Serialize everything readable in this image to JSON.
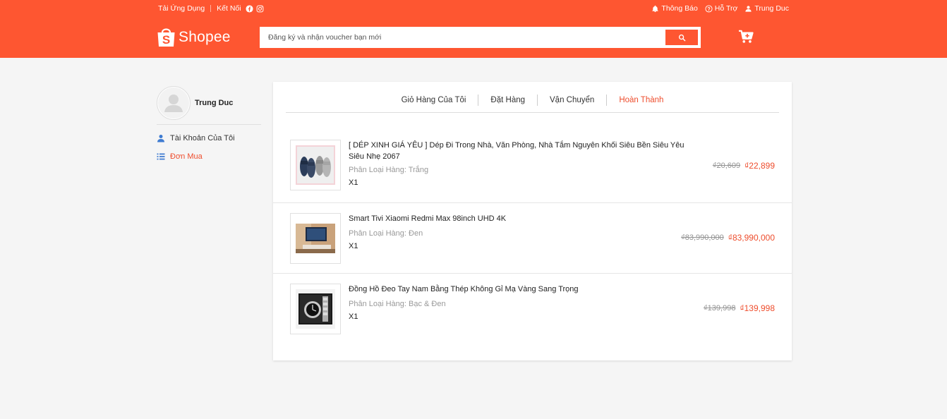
{
  "colors": {
    "brand": "#fe5631",
    "accent": "#ee4d2d"
  },
  "topbar": {
    "download_app": "Tải Ứng Dụng",
    "connect": "Kết Nối",
    "notifications": "Thông Báo",
    "help": "Hỗ Trợ",
    "user": "Trung Duc"
  },
  "logo": {
    "text": "Shopee"
  },
  "search": {
    "placeholder": "Đăng ký và nhận voucher bạn mới"
  },
  "sidebar": {
    "username": "Trung Duc",
    "items": [
      {
        "label": "Tài Khoản Của Tôi",
        "icon": "user-icon"
      },
      {
        "label": "Đơn Mua",
        "icon": "list-icon",
        "active": true
      }
    ]
  },
  "tabs": [
    {
      "label": "Giỏ Hàng Của Tôi"
    },
    {
      "label": "Đặt Hàng"
    },
    {
      "label": "Vận Chuyển"
    },
    {
      "label": "Hoàn Thành",
      "active": true
    }
  ],
  "orders": [
    {
      "title": "[ DÉP XINH GIÁ YÊU ] Dép Đi Trong Nhà, Văn Phòng, Nhà Tắm Nguyên Khối Siêu Bền Siêu Yêu Siêu Nhẹ 2067",
      "variant": "Phân Loại Hàng: Trắng",
      "qty": "X1",
      "old_price": "₫20,609",
      "price": "₫22,899"
    },
    {
      "title": "Smart Tivi Xiaomi Redmi Max 98inch UHD 4K",
      "variant": "Phân Loại Hàng: Đen",
      "qty": "X1",
      "old_price": "₫83,990,000",
      "price": "₫83,990,000"
    },
    {
      "title": "Đồng Hồ Đeo Tay Nam Bằng Thép Không Gỉ Mạ Vàng Sang Trọng",
      "variant": "Phân Loại Hàng: Bạc & Đen",
      "qty": "X1",
      "old_price": "₫139,998",
      "price": "₫139,998"
    }
  ]
}
